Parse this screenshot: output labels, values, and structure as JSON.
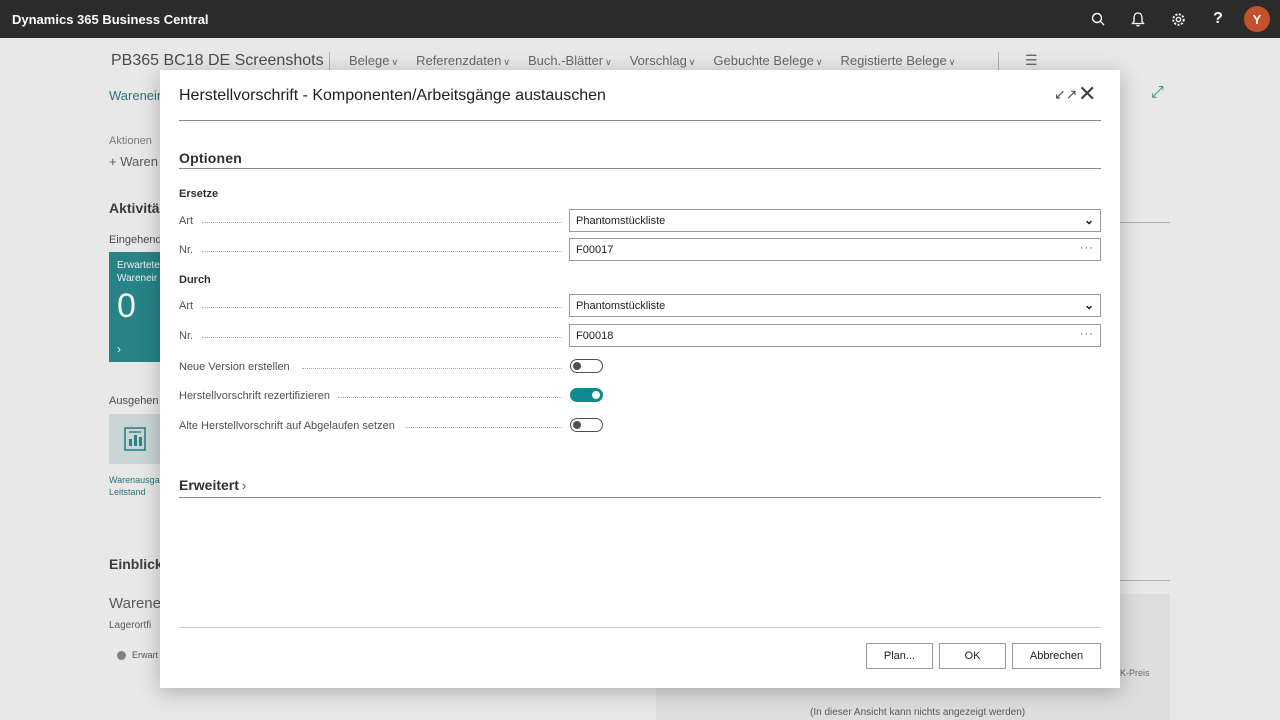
{
  "app": {
    "title": "Dynamics 365 Business Central",
    "avatar_letter": "Y"
  },
  "topbar_icons": [
    "search-icon",
    "bell-icon",
    "gear-icon",
    "help-icon"
  ],
  "background": {
    "company": "PB365 BC18 DE Screenshots",
    "nav": [
      "Belege",
      "Referenzdaten",
      "Buch.-Blätter",
      "Vorschlag",
      "Gebuchte Belege",
      "Registierte Belege"
    ],
    "breadcrumb": "Wareneir",
    "aktionen": "Aktionen",
    "neu": "+ Waren",
    "aktivitaeten": "Aktivitä",
    "eingehend": "Eingehend",
    "tile_line1": "Erwartete",
    "tile_line2": "Wareneir",
    "tile_value": "0",
    "ausgehend": "Ausgehen",
    "tile2_line1": "Warenausga",
    "tile2_line2": "Leitstand",
    "einblicke": "Einblick",
    "warene": "Warene",
    "lagerort": "Lagerortfi",
    "erwart": "Erwart",
    "kpreis": "K-Preis",
    "noview": "(In dieser Ansicht kann nichts angezeigt werden)"
  },
  "dialog": {
    "title": "Herstellvorschrift - Komponenten/Arbeitsgänge austauschen",
    "section_optionen": "Optionen",
    "group_ersetze": "Ersetze",
    "group_durch": "Durch",
    "fields": {
      "ersetze_art_label": "Art",
      "ersetze_art_value": "Phantomstückliste",
      "ersetze_nr_label": "Nr.",
      "ersetze_nr_value": "F00017",
      "durch_art_label": "Art",
      "durch_art_value": "Phantomstückliste",
      "durch_nr_label": "Nr.",
      "durch_nr_value": "F00018"
    },
    "toggles": {
      "neue_version_label": "Neue Version erstellen",
      "neue_version_on": false,
      "rezertifizieren_label": "Herstellvorschrift rezertifizieren",
      "rezertifizieren_on": true,
      "abgelaufen_label": "Alte Herstellvorschrift auf Abgelaufen setzen",
      "abgelaufen_on": false
    },
    "section_erweitert": "Erweitert",
    "buttons": {
      "plan": "Plan...",
      "ok": "OK",
      "cancel": "Abbrechen"
    }
  },
  "colors": {
    "accent": "#108b8d",
    "appbar": "#2b2b2b",
    "avatar": "#c2512c"
  }
}
